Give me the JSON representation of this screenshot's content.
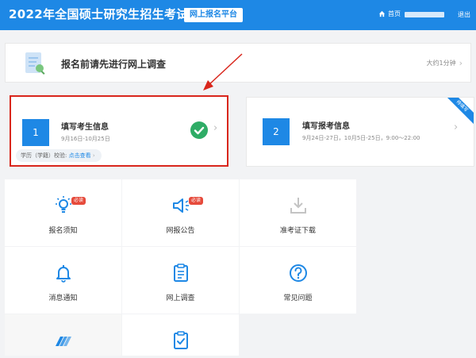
{
  "header": {
    "title": "2022年全国硕士研究生招生考试",
    "platform_badge": "网上报名平台",
    "home_label": "首页",
    "logout_label": "退出"
  },
  "survey": {
    "label": "报名前请先进行网上调查",
    "time": "大约1分钟"
  },
  "steps": [
    {
      "number": "1",
      "title": "填写考生信息",
      "date": "9月16日-10月25日",
      "verify_prefix": "学历（学籍）校验:",
      "verify_link": "点击查看"
    },
    {
      "number": "2",
      "title": "填写报考信息",
      "date": "9月24日-27日，10月5日-25日，9:00～22:00",
      "ribbon": "待填写"
    }
  ],
  "tiles": [
    {
      "label": "报名须知",
      "icon": "lightbulb-icon",
      "badge": "必读"
    },
    {
      "label": "网报公告",
      "icon": "megaphone-icon",
      "badge": "必读"
    },
    {
      "label": "准考证下载",
      "icon": "download-icon"
    },
    {
      "label": "消息通知",
      "icon": "bell-icon"
    },
    {
      "label": "网上调查",
      "icon": "clipboard-icon"
    },
    {
      "label": "常见问题",
      "icon": "question-icon"
    },
    {
      "label": "",
      "icon": "tickets-icon"
    },
    {
      "label": "",
      "icon": "checklist-icon"
    }
  ],
  "colors": {
    "brand": "#1e88e5",
    "highlight_border": "#d9261c",
    "success": "#2fac66",
    "badge": "#e64a3b"
  }
}
